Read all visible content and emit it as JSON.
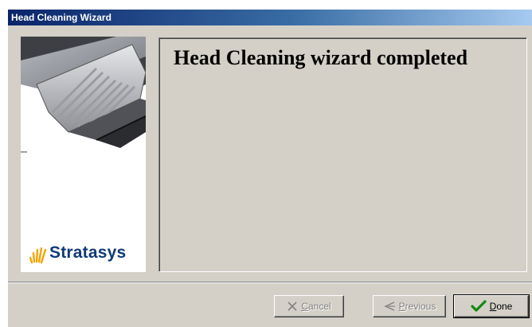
{
  "window": {
    "title": "Head Cleaning Wizard"
  },
  "side_panel": {
    "logo_text": "Stratasys"
  },
  "content": {
    "heading": "Head Cleaning wizard completed"
  },
  "buttons": {
    "cancel": {
      "accel": "C",
      "rest": "ancel",
      "enabled": false,
      "icon": "x-icon"
    },
    "previous": {
      "accel": "P",
      "rest": "revious",
      "enabled": false,
      "icon": "arrow-left-icon"
    },
    "done": {
      "accel": "D",
      "rest": "one",
      "enabled": true,
      "icon": "checkmark-icon"
    }
  },
  "colors": {
    "face": "#d4d0c8",
    "title_start": "#0a246a",
    "title_end": "#a6caf0",
    "check": "#108a10",
    "brand_blue": "#0f3a78",
    "brand_orange": "#f5a200"
  }
}
